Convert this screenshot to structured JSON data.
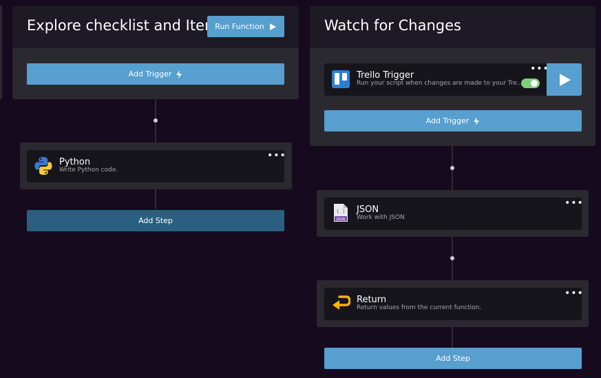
{
  "left_workflow": {
    "title": "Explore checklist and Items",
    "run_button": "Run Function",
    "add_trigger": "Add Trigger",
    "steps": [
      {
        "name": "Python",
        "description": "Write Python code.",
        "icon": "python-icon"
      }
    ],
    "add_step": "Add Step"
  },
  "right_workflow": {
    "title": "Watch for Changes",
    "trigger": {
      "name": "Trello Trigger",
      "description": "Run your script when changes are made to your Tre...",
      "icon": "trello-icon",
      "enabled": true
    },
    "add_trigger": "Add Trigger",
    "steps": [
      {
        "name": "JSON",
        "description": "Work with JSON",
        "icon": "json-file-icon"
      },
      {
        "name": "Return",
        "description": "Return values from the current function.",
        "icon": "return-arrow-icon"
      }
    ],
    "add_step": "Add Step"
  },
  "colors": {
    "background": "#160a1e",
    "panel": "#2b2930",
    "card": "#17151c",
    "accent_blue": "#569fce",
    "add_step_dark": "#2a5f7f",
    "toggle_on": "#7ed07a"
  }
}
